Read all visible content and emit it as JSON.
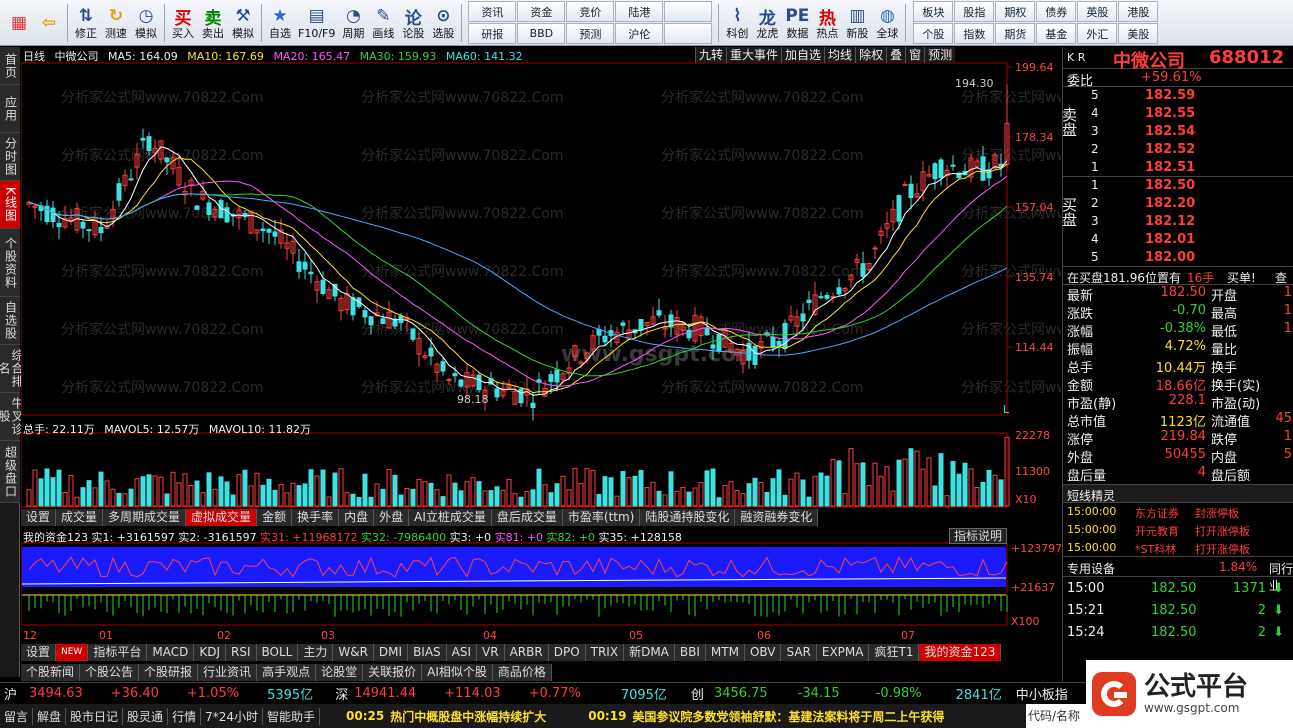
{
  "toolbar": {
    "buttons": [
      {
        "label": "",
        "icon": "windows-logo-icon"
      },
      {
        "label": "",
        "icon": "back-arrow-icon"
      },
      {
        "label": "修正",
        "icon": "up-down-arrows-icon"
      },
      {
        "label": "测速",
        "icon": "clock-refresh-icon"
      },
      {
        "label": "模拟",
        "icon": "clock-icon"
      },
      {
        "label": "买入",
        "icon": "buy-icon"
      },
      {
        "label": "卖出",
        "icon": "sell-icon"
      },
      {
        "label": "模拟",
        "icon": "hammer-icon"
      },
      {
        "label": "自选",
        "icon": "star-icon"
      },
      {
        "label": "F10/F9",
        "icon": "f10-icon"
      },
      {
        "label": "周期",
        "icon": "period-icon"
      },
      {
        "label": "画线",
        "icon": "pencil-icon"
      },
      {
        "label": "论股",
        "icon": "discuss-icon"
      },
      {
        "label": "选股",
        "icon": "search-chart-icon"
      }
    ],
    "grid": [
      "资讯",
      "资金",
      "竞价",
      "陆港",
      "",
      "研报",
      "BBD",
      "预测",
      "沪伦",
      ""
    ],
    "buttons2": [
      {
        "label": "科创",
        "icon": "sci-chart-icon"
      },
      {
        "label": "龙虎",
        "icon": "dragon-icon"
      },
      {
        "label": "数据",
        "icon": "pe-icon"
      },
      {
        "label": "热点",
        "icon": "hot-icon"
      },
      {
        "label": "新股",
        "icon": "new-stock-icon"
      },
      {
        "label": "全球",
        "icon": "globe-icon"
      }
    ],
    "right_grid": [
      "板块",
      "股指",
      "期权",
      "债券",
      "英股",
      "港股",
      "个股",
      "指数",
      "期货",
      "基金",
      "外汇",
      "美股"
    ]
  },
  "left_tabs": [
    "首页",
    "应用",
    "分时图",
    "K线图",
    "个股资料",
    "自选股",
    "综合排名",
    "牛叉诊股",
    "超级盘口"
  ],
  "chart_header": {
    "period": "日线",
    "name": "中微公司",
    "ma5": "MA5: 164.09",
    "ma10": "MA10: 167.69",
    "ma20": "MA20: 165.47",
    "ma30": "MA30: 159.93",
    "ma60": "MA60: 141.32"
  },
  "chart_buttons": [
    "九转",
    "重大事件",
    "加自选",
    "均线",
    "除权",
    "叠",
    "窗",
    "预测"
  ],
  "price_axis": [
    "199.64",
    "178.34",
    "157.04",
    "135.74",
    "114.44"
  ],
  "annotations": {
    "high": "194.30",
    "low": "98.18",
    "watermark": "分析家公式网www.70822.Com",
    "center_wm": "www.gsgpt.com"
  },
  "volume_header": {
    "total": "总手: 22.11万",
    "mavol5": "MAVOL5: 12.57万",
    "mavol10": "MAVOL10: 11.82万"
  },
  "volume_axis": [
    "22278",
    "11300",
    "X10"
  ],
  "chart_tabs": [
    "设置",
    "成交量",
    "多周期成交量",
    "虚拟成交量",
    "金额",
    "换手率",
    "内盘",
    "外盘",
    "AI立桩成交量",
    "盘后成交量",
    "市盈率(ttm)",
    "陆股通持股变化",
    "融资融券变化"
  ],
  "indicator_header": {
    "name": "我的资金123",
    "v1": "实1: +3161597",
    "v2": "实2: -3161597",
    "v31": "实31: +11968172",
    "v32": "实32: -7986400",
    "v3": "实3: +0",
    "v81": "实81: +0",
    "v82": "实82: +0",
    "v35": "实35: +128158"
  },
  "indicator_button": "指标说明",
  "indicator_axis": [
    "+123797",
    "+21637",
    "X100"
  ],
  "months": [
    "12",
    "01",
    "02",
    "03",
    "04",
    "05",
    "06",
    "07"
  ],
  "indicator_tabs": [
    "设置",
    "NEW",
    "指标平台",
    "MACD",
    "KDJ",
    "RSI",
    "BOLL",
    "主力",
    "W&R",
    "DMI",
    "BIAS",
    "ASI",
    "VR",
    "ARBR",
    "DPO",
    "TRIX",
    "新DMA",
    "BBI",
    "MTM",
    "OBV",
    "SAR",
    "EXPMA",
    "疯狂T1",
    "我的资金123"
  ],
  "news_tabs": [
    "个股新闻",
    "个股公告",
    "个股研报",
    "行业资讯",
    "高手观点",
    "论股堂",
    "关联报价",
    "AI相似个股",
    "商品价格"
  ],
  "quote": {
    "code_prefix": "K R",
    "name": "中微公司",
    "code": "688012",
    "weibi_label": "委比",
    "weibi": "+59.61%",
    "sell_label": "卖盘",
    "buy_label": "买盘",
    "sells": [
      {
        "n": "5",
        "p": "182.59"
      },
      {
        "n": "4",
        "p": "182.55"
      },
      {
        "n": "3",
        "p": "182.54"
      },
      {
        "n": "2",
        "p": "182.52"
      },
      {
        "n": "1",
        "p": "182.51"
      }
    ],
    "buys": [
      {
        "n": "1",
        "p": "182.50"
      },
      {
        "n": "2",
        "p": "182.20"
      },
      {
        "n": "3",
        "p": "182.12"
      },
      {
        "n": "4",
        "p": "182.01"
      },
      {
        "n": "5",
        "p": "182.00"
      }
    ],
    "order_line": "在买盘181.96位置有",
    "order_qty": "16手",
    "order_act": "买单!",
    "order_more": "查",
    "stats": [
      {
        "l": "最新",
        "v": "182.50",
        "l2": "开盘",
        "v2": "1"
      },
      {
        "l": "涨跌",
        "v": "-0.70",
        "l2": "最高",
        "v2": "1"
      },
      {
        "l": "涨幅",
        "v": "-0.38%",
        "l2": "最低",
        "v2": "1"
      },
      {
        "l": "振幅",
        "v": "4.72%",
        "l2": "量比",
        "v2": ""
      },
      {
        "l": "总手",
        "v": "10.44万",
        "l2": "换手",
        "v2": ""
      },
      {
        "l": "金额",
        "v": "18.66亿",
        "l2": "换手(实)",
        "v2": ""
      },
      {
        "l": "市盈(静)",
        "v": "228.1",
        "l2": "市盈(动)",
        "v2": ""
      },
      {
        "l": "总市值",
        "v": "1123亿",
        "l2": "流通值",
        "v2": "45"
      },
      {
        "l": "涨停",
        "v": "219.84",
        "l2": "跌停",
        "v2": "1"
      },
      {
        "l": "外盘",
        "v": "50455",
        "l2": "内盘",
        "v2": "5"
      },
      {
        "l": "盘后量",
        "v": "4",
        "l2": "盘后额",
        "v2": ""
      }
    ],
    "wizard_title": "短线精灵",
    "wizard": [
      {
        "t": "15:00:00",
        "s": "东方证券",
        "e": "封涨停板"
      },
      {
        "t": "15:00:00",
        "s": "开元教育",
        "e": "打开涨停板"
      },
      {
        "t": "15:00:00",
        "s": "*ST科林",
        "e": "打开涨停板"
      }
    ],
    "device_label": "专用设备",
    "device_pct": "1.84%",
    "device_peer": "同行业",
    "ticks": [
      {
        "t": "15:00",
        "p": "182.50",
        "v": "1371"
      },
      {
        "t": "15:21",
        "p": "182.50",
        "v": "2"
      },
      {
        "t": "15:24",
        "p": "182.50",
        "v": "2"
      }
    ]
  },
  "status1": {
    "sh": "沪",
    "sh_v": "3494.63",
    "sh_c": "+36.40",
    "sh_p": "+1.05%",
    "sh_a": "5395亿",
    "sz": "深",
    "sz_v": "14941.44",
    "sz_c": "+114.03",
    "sz_p": "+0.77%",
    "sz_a": "7095亿",
    "cy": "创",
    "cy_v": "3456.75",
    "cy_c": "-34.15",
    "cy_p": "-0.98%",
    "cy_a": "2841亿",
    "board": "中小板指"
  },
  "status2": {
    "items": [
      "留言",
      "解盘",
      "股市日记",
      "股灵通",
      "行情",
      "7*24小时",
      "智能助手"
    ],
    "news1_time": "00:25",
    "news1": "热门中概股盘中涨幅持续扩大",
    "news2_time": "00:19",
    "news2": "美国参议院多数党领袖舒默：基建法案料将于周二上午获得",
    "search": "代码/名称"
  },
  "logo": {
    "text": "公式平台",
    "url": "www.gsgpt.com"
  }
}
